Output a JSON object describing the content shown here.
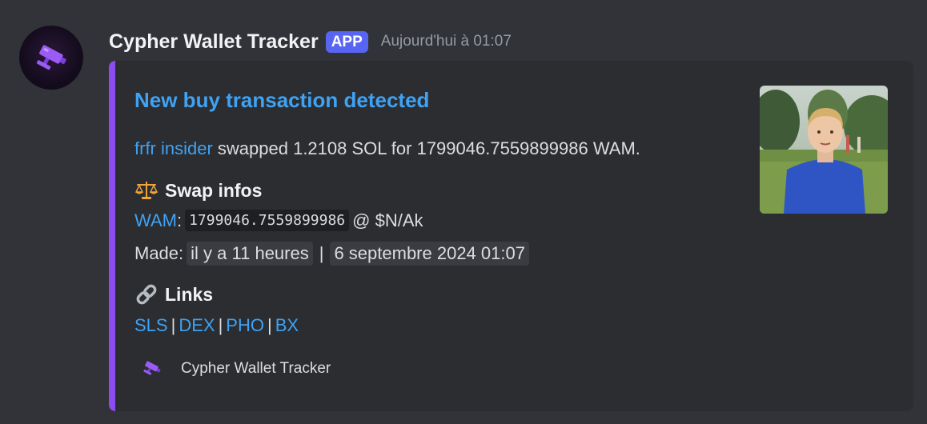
{
  "author": {
    "name": "Cypher Wallet Tracker",
    "badge": "APP",
    "timestamp": "Aujourd'hui à 01:07",
    "avatar_icon": "security-camera-icon"
  },
  "embed": {
    "accent_color": "#8c4cf0",
    "title": "New buy transaction detected",
    "description": {
      "wallet_link": "frfr insider",
      "text": " swapped 1.2108 SOL for 1799046.7559899986 WAM."
    },
    "swap_section": {
      "emoji": "balance-scale-icon",
      "title": "Swap infos",
      "token_link": "WAM",
      "colon": ":",
      "amount": "1799046.7559899986",
      "price": "@ $N/Ak",
      "made_label": "Made:",
      "relative_time": "il y a 11 heures",
      "separator": "|",
      "absolute_time": "6 septembre 2024 01:07"
    },
    "links_section": {
      "emoji": "link-icon",
      "title": "Links",
      "links": [
        "SLS",
        "DEX",
        "PHO",
        "BX"
      ],
      "separator": "|"
    },
    "thumbnail": "boy-in-park-thumbnail",
    "footer": {
      "icon": "security-camera-icon",
      "text": "Cypher Wallet Tracker"
    }
  },
  "colors": {
    "background": "#313338",
    "embed_background": "#2b2d31",
    "link": "#3fa2f3",
    "badge": "#5865f2"
  }
}
